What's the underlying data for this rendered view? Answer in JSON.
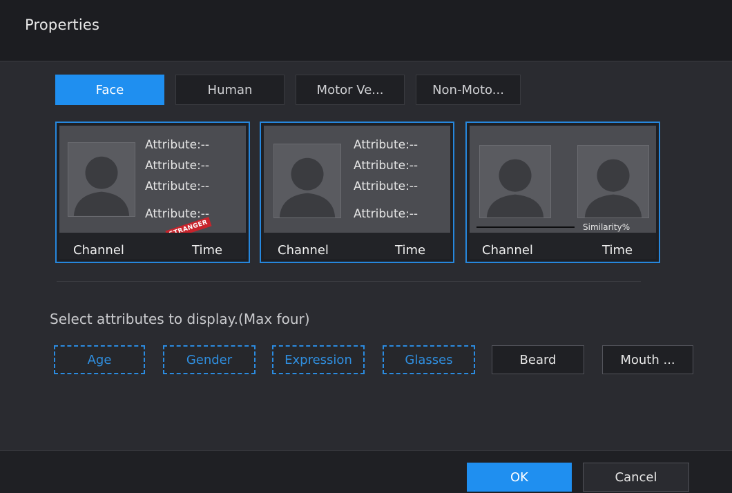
{
  "dialog": {
    "title": "Properties"
  },
  "tabs": [
    {
      "label": "Face",
      "active": true
    },
    {
      "label": "Human",
      "active": false
    },
    {
      "label": "Motor Ve...",
      "active": false
    },
    {
      "label": "Non-Moto...",
      "active": false
    }
  ],
  "cards": [
    {
      "attributes": [
        "Attribute:--",
        "Attribute:--",
        "Attribute:--",
        "Attribute:--"
      ],
      "stamp": "STRANGER",
      "channel": "Channel",
      "time": "Time"
    },
    {
      "attributes": [
        "Attribute:--",
        "Attribute:--",
        "Attribute:--",
        "Attribute:--"
      ],
      "channel": "Channel",
      "time": "Time"
    },
    {
      "similarity": "Similarity%",
      "channel": "Channel",
      "time": "Time"
    }
  ],
  "hint": "Select attributes to display.(Max four)",
  "attribute_buttons": [
    {
      "label": "Age",
      "selected": true
    },
    {
      "label": "Gender",
      "selected": true
    },
    {
      "label": "Expression",
      "selected": true
    },
    {
      "label": "Glasses",
      "selected": true
    },
    {
      "label": "Beard",
      "selected": false
    },
    {
      "label": "Mouth ...",
      "selected": false
    }
  ],
  "footer": {
    "ok_label": "OK",
    "cancel_label": "Cancel"
  },
  "colors": {
    "accent": "#1f8ff0",
    "selected_outline": "#2b8be0",
    "card_border": "#2687dd",
    "stamp": "#c8242c"
  }
}
